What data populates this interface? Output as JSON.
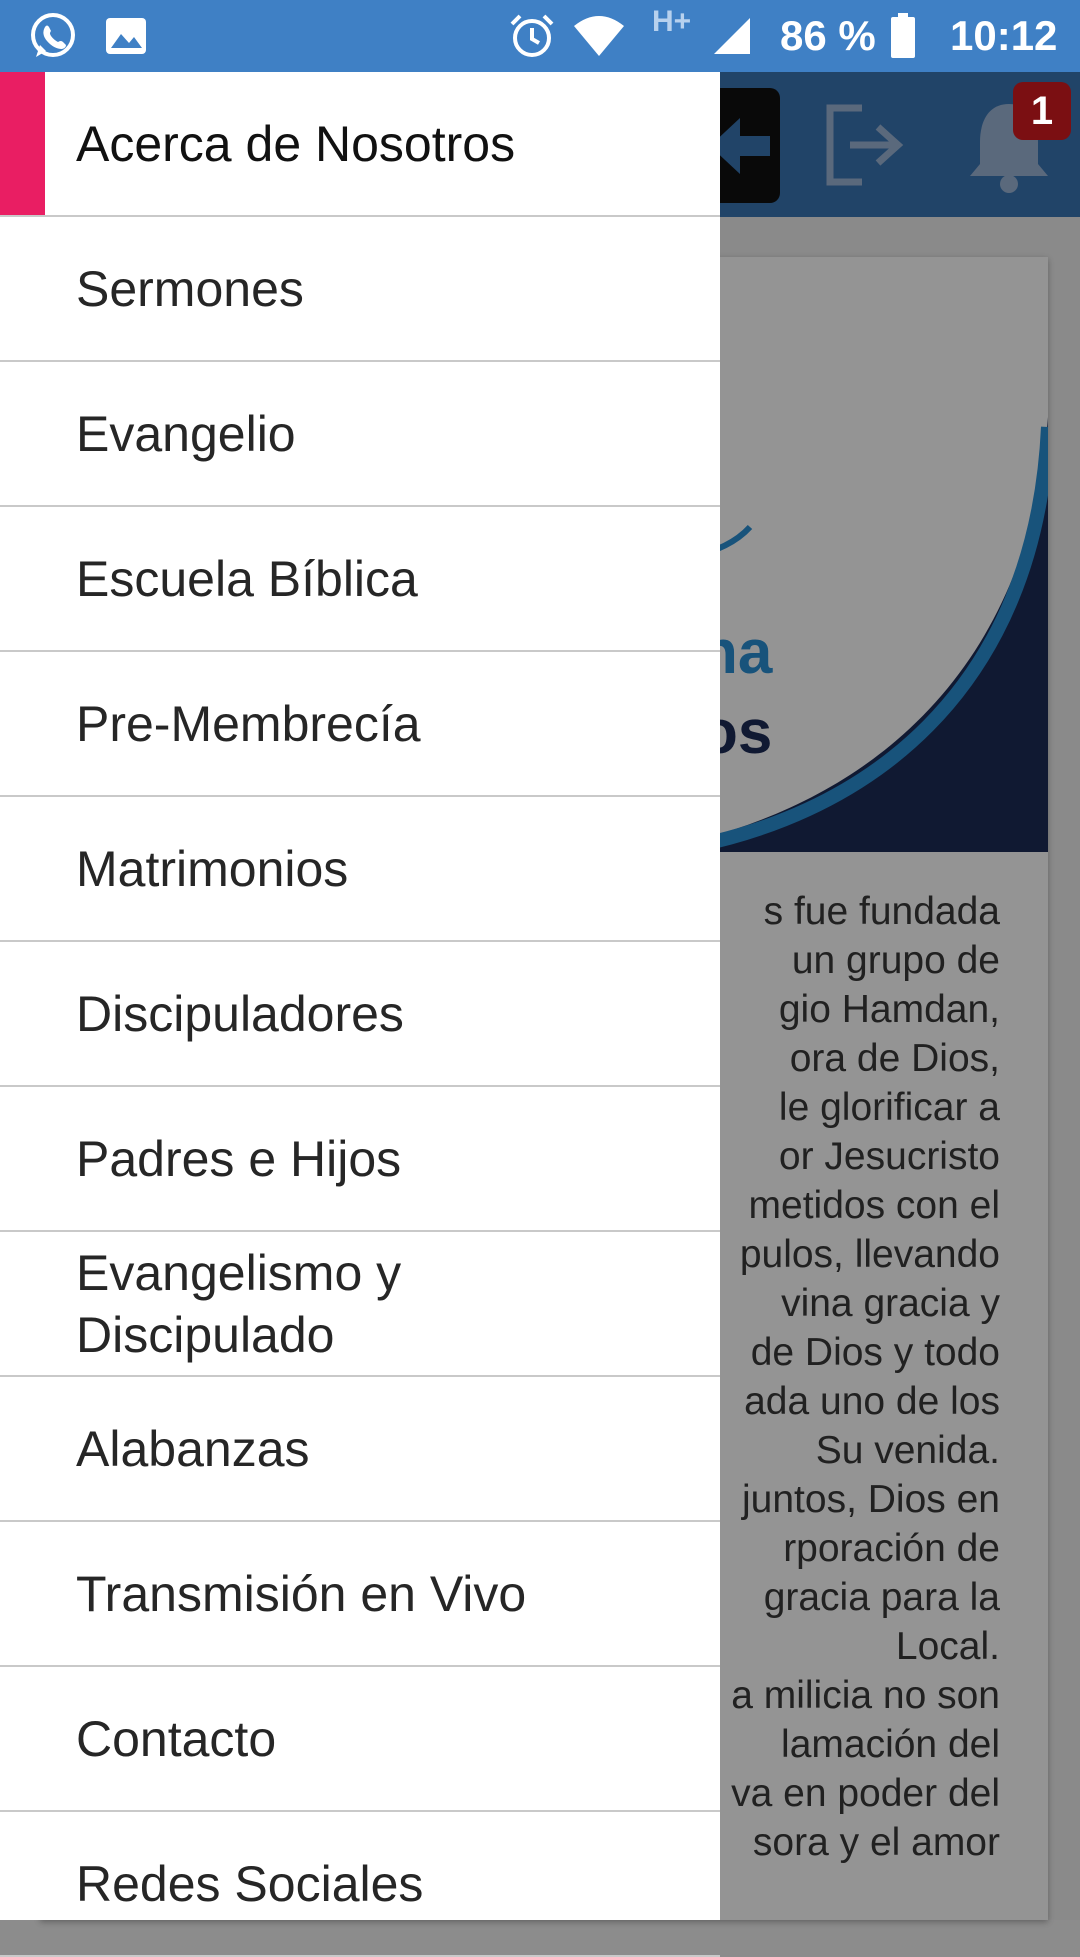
{
  "status_bar": {
    "battery_percent": "86 %",
    "time": "10:12",
    "network_label": "H+",
    "icons": [
      "whatsapp-icon",
      "image-icon",
      "alarm-icon",
      "wifi-icon",
      "signal-icon",
      "battery-icon"
    ]
  },
  "app_bar": {
    "notification_count": "1",
    "icons": [
      "back-icon",
      "logout-icon",
      "bell-icon"
    ]
  },
  "background_content": {
    "logo_partial_lines": [
      "na",
      "os"
    ],
    "body_lines": [
      "s fue fundada",
      "un grupo de",
      "gio Hamdan,",
      "ora de Dios,",
      "le glorificar a",
      "or Jesucristo",
      "metidos con el",
      "pulos, llevando",
      "vina gracia y",
      "de Dios y todo",
      "ada uno de los",
      "Su venida.",
      "juntos, Dios en",
      "rporación de",
      "gracia para la",
      "Local.",
      "a milicia no son",
      "lamación del",
      "va en poder del",
      "sora y el amor"
    ]
  },
  "drawer": {
    "items": [
      {
        "label": "Acerca de Nosotros",
        "active": true
      },
      {
        "label": "Sermones"
      },
      {
        "label": "Evangelio"
      },
      {
        "label": "Escuela Bíblica"
      },
      {
        "label": "Pre-Membrecía"
      },
      {
        "label": "Matrimonios"
      },
      {
        "label": "Discipuladores"
      },
      {
        "label": "Padres e Hijos"
      },
      {
        "label": "Evangelismo y Discipulado"
      },
      {
        "label": "Alabanzas"
      },
      {
        "label": "Transmisión en Vivo"
      },
      {
        "label": "Contacto"
      },
      {
        "label": "Redes Sociales"
      }
    ]
  },
  "colors": {
    "status_bar": "#3f80c5",
    "app_bar": "#3a75b4",
    "accent": "#e91e63",
    "badge": "#7b0f12"
  }
}
